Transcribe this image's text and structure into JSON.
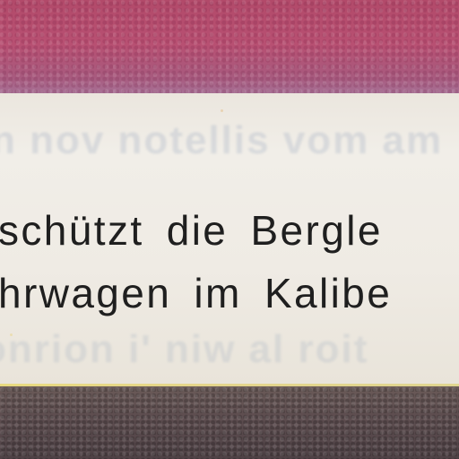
{
  "document": {
    "text_lines": [
      "schützt die Bergle",
      "hrwagen im Kalibe"
    ]
  },
  "colors": {
    "top_band": "#b24a6a",
    "paper": "#efebe4",
    "ink": "#1f1f1f",
    "bottom_band": "#5e4e50"
  }
}
